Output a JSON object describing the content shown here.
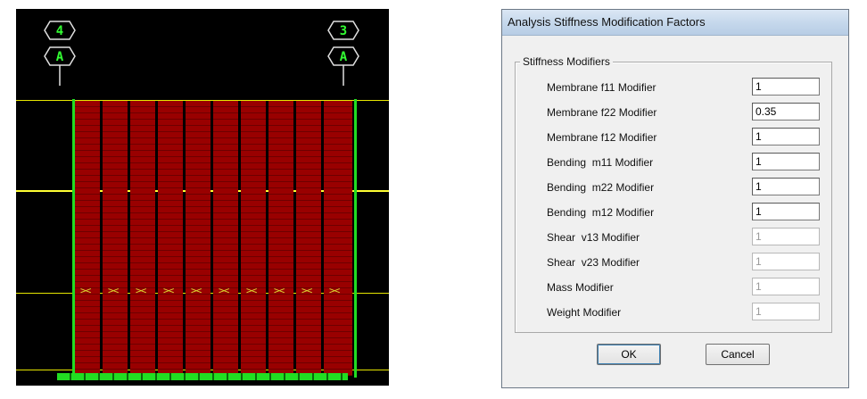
{
  "model_view": {
    "grid_bubbles": [
      {
        "top": "4",
        "bottom": "A"
      },
      {
        "top": "3",
        "bottom": "A"
      }
    ],
    "colors": {
      "background": "#000000",
      "wall": "#990000",
      "grid_line": "#33ff33",
      "story_line": "#e6e600"
    },
    "wall_panel_count": 10
  },
  "dialog": {
    "title": "Analysis Stiffness Modification Factors",
    "group_label": "Stiffness Modifiers",
    "fields": [
      {
        "label": "Membrane f11 Modifier",
        "value": "1",
        "enabled": true
      },
      {
        "label": "Membrane f22 Modifier",
        "value": "0.35",
        "enabled": true
      },
      {
        "label": "Membrane f12 Modifier",
        "value": "1",
        "enabled": true
      },
      {
        "label": "Bending  m11 Modifier",
        "value": "1",
        "enabled": true
      },
      {
        "label": "Bending  m22 Modifier",
        "value": "1",
        "enabled": true
      },
      {
        "label": "Bending  m12 Modifier",
        "value": "1",
        "enabled": true
      },
      {
        "label": "Shear  v13 Modifier",
        "value": "1",
        "enabled": false
      },
      {
        "label": "Shear  v23 Modifier",
        "value": "1",
        "enabled": false
      },
      {
        "label": "Mass Modifier",
        "value": "1",
        "enabled": false
      },
      {
        "label": "Weight Modifier",
        "value": "1",
        "enabled": false
      }
    ],
    "ok_label": "OK",
    "cancel_label": "Cancel"
  }
}
